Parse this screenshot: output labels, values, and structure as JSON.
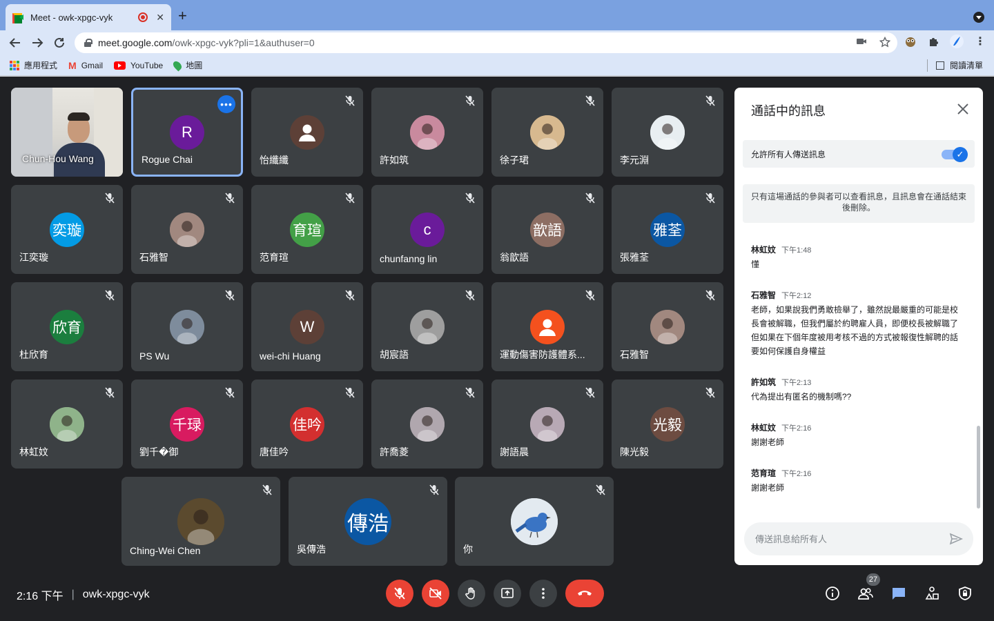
{
  "browser": {
    "tab_title": "Meet - owk-xpgc-vyk",
    "url_host": "meet.google.com",
    "url_path": "/owk-xpgc-vyk?pli=1&authuser=0",
    "bookmarks": [
      "應用程式",
      "Gmail",
      "YouTube",
      "地圖"
    ],
    "reading_list": "閱讀清單"
  },
  "participants": [
    {
      "name": "Chun-Hou Wang",
      "type": "video"
    },
    {
      "name": "Rogue Chai",
      "initial": "R",
      "color": "#6a1b9a",
      "active": true
    },
    {
      "name": "怡纖纖",
      "icon": "default-person-icon",
      "color": "#5d4037"
    },
    {
      "name": "許如筑",
      "icon": "sunset-photo-icon",
      "color": "#c98a9e"
    },
    {
      "name": "徐子珺",
      "icon": "cat-photo-icon",
      "color": "#d7b98f"
    },
    {
      "name": "李元淵",
      "icon": "logo-photo-icon",
      "color": "#e8eef1"
    },
    {
      "name": "江奕璇",
      "initial": "奕璇",
      "color": "#039be5"
    },
    {
      "name": "石雅智",
      "icon": "girl-photo-icon",
      "color": "#a1887f"
    },
    {
      "name": "范育瑄",
      "initial": "育瑄",
      "color": "#43a047"
    },
    {
      "name": "chunfanng lin",
      "initial": "c",
      "color": "#6a1b9a"
    },
    {
      "name": "翁歆語",
      "initial": "歆語",
      "color": "#8d6e63"
    },
    {
      "name": "張雅荃",
      "initial": "雅荃",
      "color": "#0b57a3"
    },
    {
      "name": "杜欣育",
      "initial": "欣育",
      "color": "#1b7e3e"
    },
    {
      "name": "PS Wu",
      "icon": "friends-photo-icon",
      "color": "#7e8c9c"
    },
    {
      "name": "wei-chi Huang",
      "initial": "W",
      "color": "#5d4037"
    },
    {
      "name": "胡宸語",
      "icon": "woman-photo-icon",
      "color": "#9e9e9e"
    },
    {
      "name": "運動傷害防護體系...",
      "icon": "default-person-icon",
      "color": "#f4511e"
    },
    {
      "name": "石雅智",
      "icon": "girl-photo-icon",
      "color": "#a1887f"
    },
    {
      "name": "林虹妏",
      "icon": "landscape-photo-icon",
      "color": "#8fb38a"
    },
    {
      "name": "劉千�御",
      "initial": "千琭",
      "color": "#d81b60"
    },
    {
      "name": "唐佳吟",
      "initial": "佳吟",
      "color": "#d32f2f"
    },
    {
      "name": "許喬菱",
      "icon": "portrait-photo-icon",
      "color": "#b0a7ae"
    },
    {
      "name": "謝語晨",
      "icon": "portrait-photo-icon",
      "color": "#b8a9b5"
    },
    {
      "name": "陳光毅",
      "initial": "光毅",
      "color": "#6d4c41"
    },
    {
      "name": "Ching-Wei Chen",
      "icon": "man-photo-icon",
      "color": "#5b4a2e",
      "wide": true
    },
    {
      "name": "吳傳浩",
      "initial": "傳浩",
      "color": "#0b57a3",
      "wide": true
    },
    {
      "name": "你",
      "icon": "bird-photo-icon",
      "color": "#dfe6ec",
      "wide": true
    }
  ],
  "chat": {
    "title": "通話中的訊息",
    "allow_label": "允許所有人傳送訊息",
    "allow_enabled": true,
    "notice": "只有這場通話的參與者可以查看訊息，且訊息會在通話結束後刪除。",
    "messages": [
      {
        "sender": "林虹妏",
        "time": "下午1:48",
        "text": "懂"
      },
      {
        "sender": "石雅智",
        "time": "下午2:12",
        "text": "老師，如果說我們勇敢檢舉了，雖然說最嚴重的可能是校長會被解職，但我們屬於約聘雇人員，即便校長被解職了但如果在下個年度被用考核不過的方式被報復性解聘的話要如何保護自身權益"
      },
      {
        "sender": "許如筑",
        "time": "下午2:13",
        "text": "代為提出有匿名的機制嗎??"
      },
      {
        "sender": "林虹妏",
        "time": "下午2:16",
        "text": "謝謝老師"
      },
      {
        "sender": "范育瑄",
        "time": "下午2:16",
        "text": "謝謝老師"
      }
    ],
    "input_placeholder": "傳送訊息給所有人"
  },
  "bottom": {
    "time": "2:16 下午",
    "separator": "|",
    "meeting_code": "owk-xpgc-vyk",
    "participant_count": "27"
  }
}
